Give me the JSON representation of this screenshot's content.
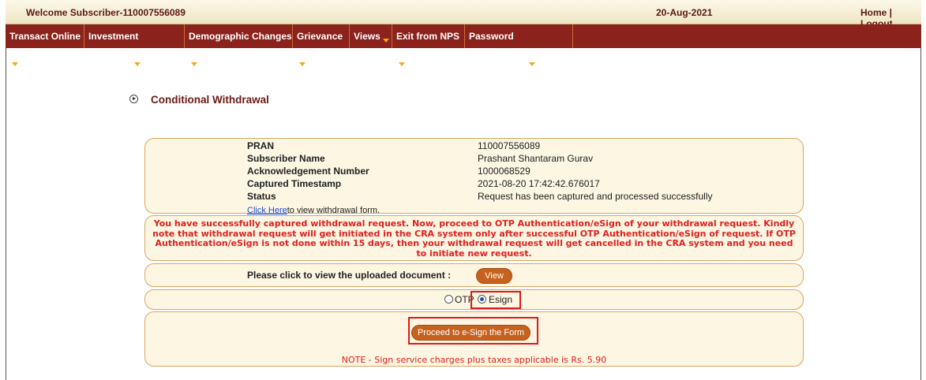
{
  "header": {
    "welcome": "Welcome Subscriber-110007556089",
    "date": "20-Aug-2021",
    "home_link": "Home",
    "separator": " | ",
    "logout_link": "Logout"
  },
  "menu": {
    "items": [
      {
        "label": "Transact Online"
      },
      {
        "label": "Investment Summary"
      },
      {
        "label": "Demographic Changes"
      },
      {
        "label": "Grievance"
      },
      {
        "label": "Views"
      },
      {
        "label": "Exit from NPS"
      },
      {
        "label": "Password Management"
      }
    ]
  },
  "section": {
    "title": "Conditional Withdrawal"
  },
  "details": {
    "rows": [
      {
        "label": "PRAN",
        "value": "110007556089"
      },
      {
        "label": "Subscriber Name",
        "value": "Prashant Shantaram Gurav"
      },
      {
        "label": "Acknowledgement Number",
        "value": "1000068529"
      },
      {
        "label": "Captured Timestamp",
        "value": "2021-08-20 17:42:42.676017"
      },
      {
        "label": "Status",
        "value": "Request has been captured and processed successfully"
      }
    ],
    "link_text": "Click Here",
    "link_suffix": "to view withdrawal form."
  },
  "message": "You have successfully captured withdrawal request. Now, proceed to OTP Authentication/eSign of your withdrawal request. Kindly note that withdrawal request will get initiated in the CRA system only after successful OTP Authentication/eSign of request. If OTP Authentication/eSign is not done within 15 days, then your withdrawal request will get cancelled in the CRA system and you need to initiate new request.",
  "document": {
    "label": "Please click to view the uploaded document :",
    "view_button": "View"
  },
  "auth": {
    "options": [
      {
        "label": "OTP",
        "selected": false
      },
      {
        "label": "Esign",
        "selected": true
      }
    ]
  },
  "esign": {
    "proceed_button": "Proceed to e-Sign the Form",
    "note": "NOTE - Sign service charges plus taxes applicable is Rs. 5.90"
  },
  "colors": {
    "menu_bg": "#8b221b",
    "title": "#6b1a14",
    "button": "#c6621d",
    "alert": "#e02020",
    "highlight": "#e0191d"
  }
}
